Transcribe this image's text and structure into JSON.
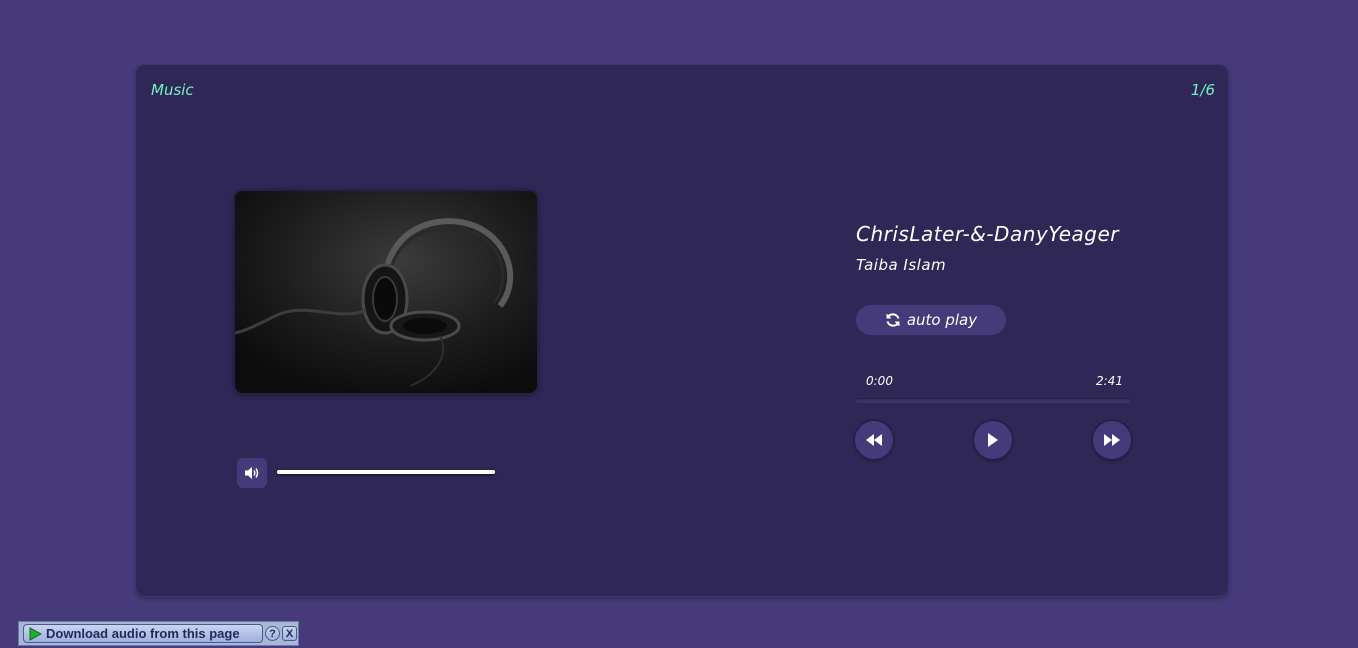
{
  "header": {
    "title": "Music",
    "track_count": "1/6"
  },
  "track": {
    "title": "ChrisLater-&-DanyYeager",
    "artist": "Taiba Islam",
    "current_time": "0:00",
    "total_time": "2:41",
    "progress": 0
  },
  "controls": {
    "autoplay_label": "auto play"
  },
  "volume": {
    "level": 1.0
  },
  "download_bar": {
    "label": "Download audio from this page",
    "help": "?",
    "close": "X"
  },
  "colors": {
    "page_bg": "#463a7a",
    "card_bg": "#2f2856",
    "accent": "#74f0c6",
    "button_bg": "#463a7a"
  },
  "icons": {
    "autoplay": "refresh-icon",
    "volume": "volume-icon",
    "previous": "rewind-icon",
    "play": "play-icon",
    "next": "fast-forward-icon",
    "download": "play-triangle-icon"
  }
}
